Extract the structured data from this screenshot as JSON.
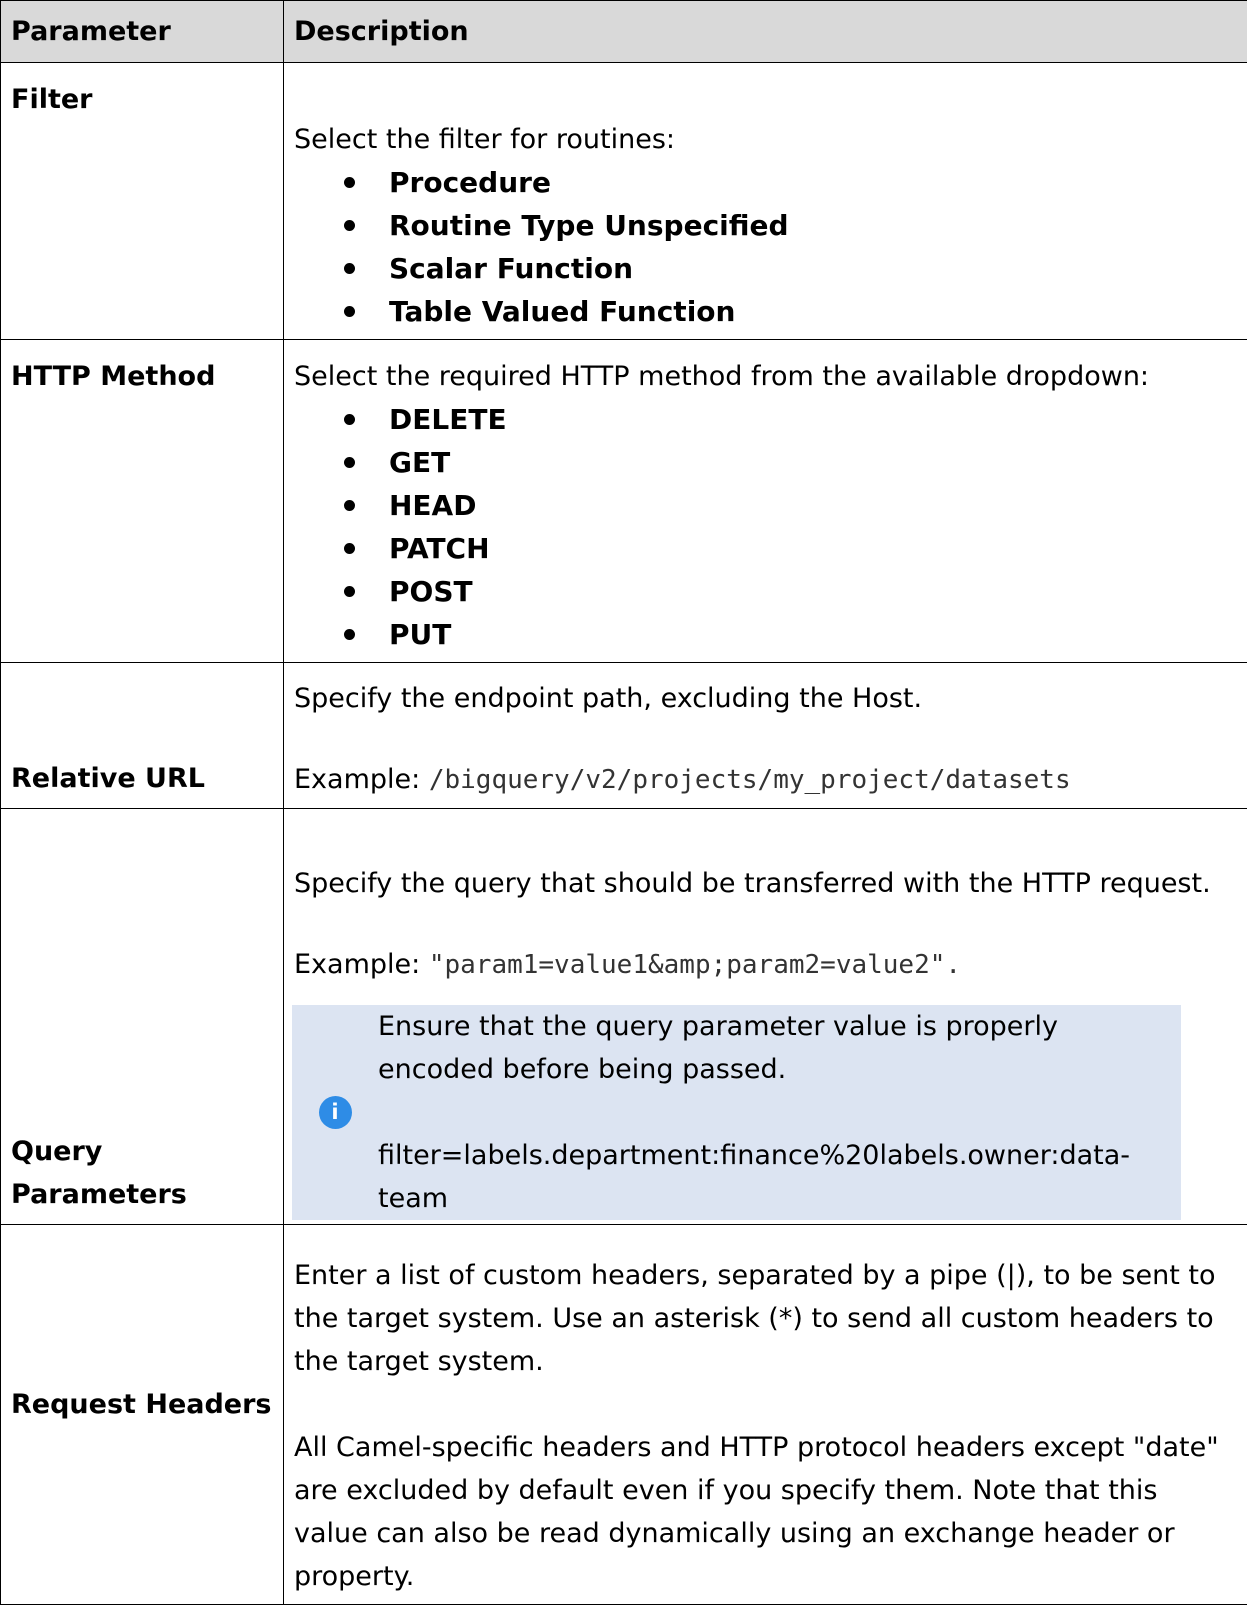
{
  "table": {
    "headers": {
      "parameter": "Parameter",
      "description": "Description"
    },
    "filter": {
      "name": "Filter",
      "intro": "Select the filter for routines:",
      "options": [
        "Procedure",
        "Routine Type Unspecified",
        "Scalar Function",
        "Table Valued Function"
      ]
    },
    "http_method": {
      "name": "HTTP Method",
      "intro": "Select the required HTTP method from the available dropdown:",
      "options": [
        "DELETE",
        "GET",
        "HEAD",
        "PATCH",
        "POST",
        "PUT"
      ]
    },
    "relative_url": {
      "name": "Relative URL",
      "text": "Specify the endpoint path, excluding the Host.",
      "example_label": "Example: ",
      "example_value": "/bigquery/v2/projects/my_project/datasets"
    },
    "query_parameters": {
      "name": "Query Parameters",
      "text": "Specify the query that should be transferred with the HTTP request.",
      "example_label": "Example: ",
      "example_open_quote": "\"",
      "example_value": "param1=value1&amp;param2=value2",
      "example_close": "\".",
      "note_text": "Ensure that the query parameter value is properly encoded before being passed.",
      "note_example": "filter=labels.department:finance%20labels.owner:data-team",
      "note_icon": "info-icon",
      "note_color": "#dce4f2",
      "icon_color": "#2e8ce6"
    },
    "request_headers": {
      "name": "Request Headers",
      "text1": "Enter a list of custom headers, separated by a pipe (|), to be sent to the target system. Use an asterisk (*) to send all custom headers to the target system.",
      "text2": "All Camel-specific headers and HTTP protocol headers except \"date\" are excluded by default even if you specify them. Note that this value can also be read dynamically using an exchange header or property."
    }
  }
}
